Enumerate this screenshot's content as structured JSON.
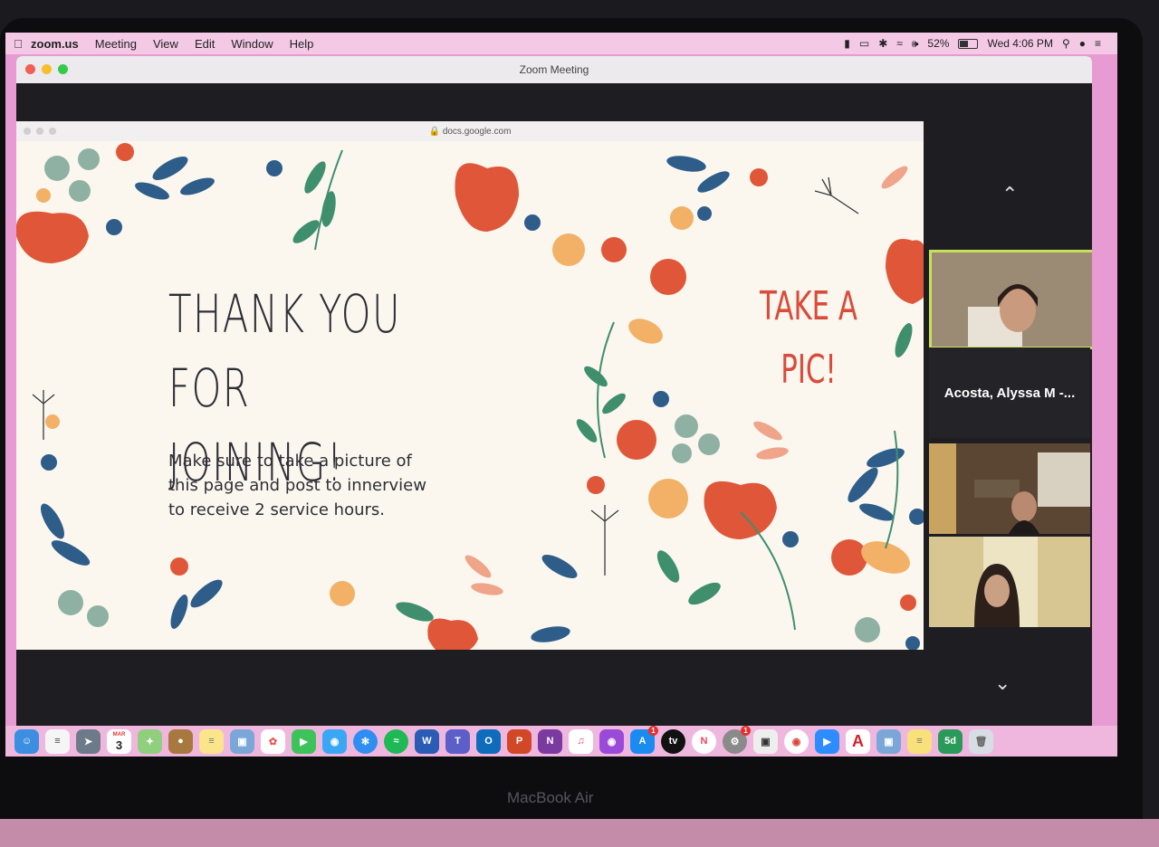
{
  "menubar": {
    "app": "zoom.us",
    "items": [
      "Meeting",
      "View",
      "Edit",
      "Window",
      "Help"
    ],
    "battery": "52%",
    "clock": "Wed 4:06 PM"
  },
  "zoom": {
    "window_title": "Zoom Meeting"
  },
  "browser": {
    "url": "docs.google.com"
  },
  "slide": {
    "title_line1": "Thank you for",
    "title_line2": "joining!",
    "body": "Make sure to take a picture of this page and post to innerview to receive 2 service hours.",
    "side_line1": "Take a",
    "side_line2": "pic!"
  },
  "participants": {
    "name_tile": "Acosta, Alyssa M -..."
  },
  "laptop": {
    "brand": "MacBook Air"
  },
  "dock": {
    "icons": [
      "finder-icon",
      "reminders-icon",
      "launchpad-icon",
      "calendar-icon",
      "maps-icon",
      "contacts-icon",
      "notes-icon",
      "preview-icon",
      "photos-icon",
      "facetime-icon",
      "messages-icon",
      "safari-icon",
      "spotify-icon",
      "word-icon",
      "teams-icon",
      "outlook-icon",
      "powerpoint-icon",
      "onenote-icon",
      "music-icon",
      "podcasts-icon",
      "appstore-icon",
      "appletv-icon",
      "news-icon",
      "systemprefs-icon",
      "screenshot-icon",
      "chrome-icon",
      "zoom-icon",
      "acrobat-icon",
      "preview2-icon",
      "stickies-icon",
      "fivedays-icon",
      "trash-icon"
    ],
    "calendar_day": "3",
    "calendar_month": "MAR",
    "appstore_badge": "1",
    "systemprefs_badge": "1",
    "fivedays_label": "5d"
  }
}
